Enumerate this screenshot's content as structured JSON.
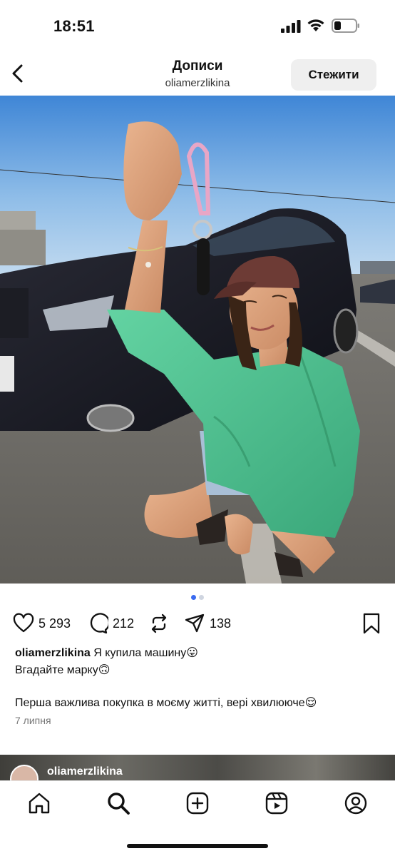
{
  "status_bar": {
    "time": "18:51"
  },
  "header": {
    "title": "Дописи",
    "subtitle": "oliamerzlikina",
    "follow_label": "Стежити"
  },
  "carousel": {
    "count": 2,
    "active_index": 0
  },
  "actions": {
    "likes": "5 293",
    "comments": "212",
    "shares": "138"
  },
  "caption": {
    "username": "oliamerzlikina",
    "text_line1": "Я купила машину😛",
    "text_line2": "Вгадайте марку🙃",
    "text_para": "Перша важлива покупка в моєму житті, верi хвилююче😌"
  },
  "post_date": "7 липня",
  "next_post": {
    "username": "oliamerzlikina"
  },
  "tabs": [
    "home-icon",
    "search-icon",
    "create-icon",
    "reels-icon",
    "profile-icon"
  ],
  "colors": {
    "accent": "#3b6bf0",
    "shirt": "#4fc08f",
    "cap": "#6d3b35"
  }
}
